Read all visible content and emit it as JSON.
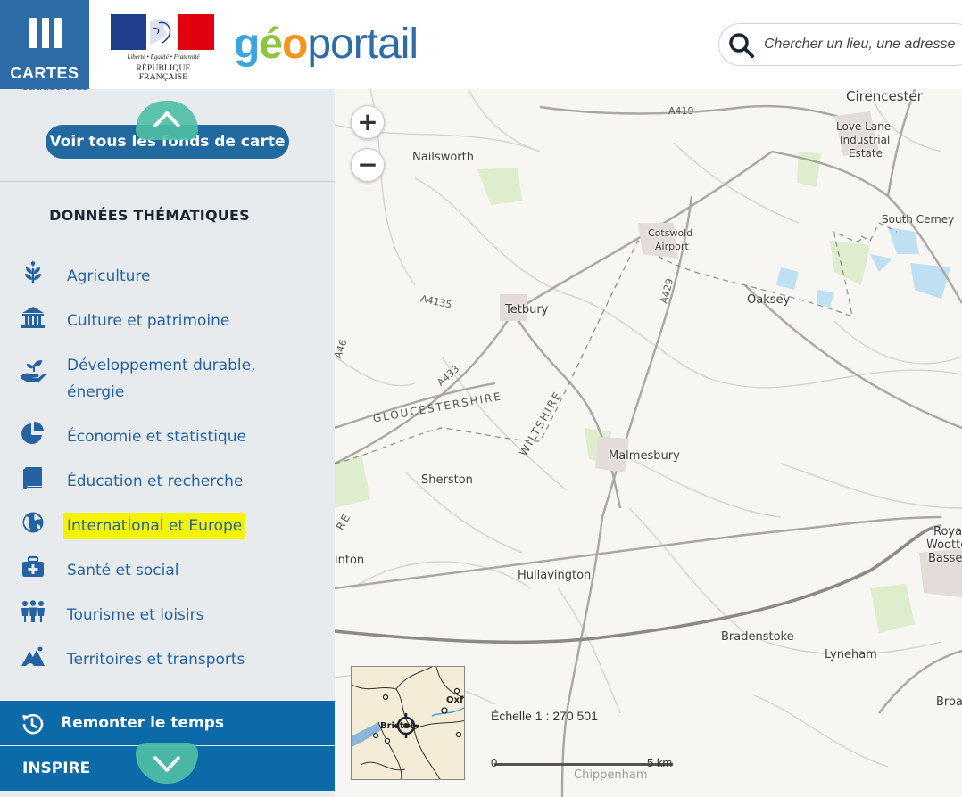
{
  "header": {
    "menu_label": "CARTES",
    "republic_motto": "Liberté • Égalité • Fraternité",
    "republic_name": "RÉPUBLIQUE FRANÇAISE",
    "logo": {
      "g": "g",
      "e": "é",
      "o": "o",
      "rest": "portail"
    },
    "search_placeholder": "Chercher un lieu, une adresse"
  },
  "sidebar": {
    "cut_label": "cadastrales",
    "voir_button": "Voir tous les fonds de carte",
    "section_title": "DONNÉES THÉMATIQUES",
    "themes": [
      {
        "label": "Agriculture",
        "icon": "sprout-icon"
      },
      {
        "label": "Culture et patrimoine",
        "icon": "museum-icon"
      },
      {
        "label": "Développement durable, énergie",
        "icon": "hand-plant-icon"
      },
      {
        "label": "Économie et statistique",
        "icon": "pie-chart-icon"
      },
      {
        "label": "Éducation et recherche",
        "icon": "book-icon"
      },
      {
        "label": "International et Europe",
        "icon": "globe-icon",
        "highlighted": true
      },
      {
        "label": "Santé et social",
        "icon": "medical-kit-icon"
      },
      {
        "label": "Tourisme et loisirs",
        "icon": "people-icon"
      },
      {
        "label": "Territoires et transports",
        "icon": "mountain-icon"
      }
    ],
    "history_button": "Remonter le temps",
    "inspire_button": "INSPIRE"
  },
  "map": {
    "zoom_in": "+",
    "zoom_out": "−",
    "places": {
      "cirencester": "Cirencester",
      "love_lane": "Love Lane",
      "industrial": "Industrial",
      "estate": "Estate",
      "nailsworth": "Nailsworth",
      "south_cerney": "South Cerney",
      "cotswold": "Cotswold",
      "airport": "Airport",
      "oaksey": "Oaksey",
      "tetbury": "Tetbury",
      "malmesbury": "Malmesbury",
      "sherston": "Sherston",
      "hullavington": "Hullavington",
      "bradenstoke": "Bradenstoke",
      "lyneham": "Lyneham",
      "royal": "Royal",
      "wootton": "Wootton",
      "bassett": "Basset",
      "broad": "Broa",
      "chippenham": "Chippenham",
      "inton": "inton"
    },
    "roads": {
      "a419": "A419",
      "a4135": "A4135",
      "a429": "A429",
      "a433": "A433",
      "a46": "A46"
    },
    "counties": {
      "gloucestershire": "GLOUCESTERSHIRE",
      "wiltshire": "WILTSHIRE",
      "re": "RE"
    },
    "overview": {
      "bristol": "Bristol",
      "oxford": "Oxf"
    },
    "scale_text": "Échelle 1 : 270 501",
    "scale_zero": "0",
    "scale_km": "5 km"
  },
  "colors": {
    "primary": "#0d6aa8",
    "accent": "#4ebfa5",
    "highlight": "#f3f207",
    "sidebar_bg": "#e8ebee"
  }
}
